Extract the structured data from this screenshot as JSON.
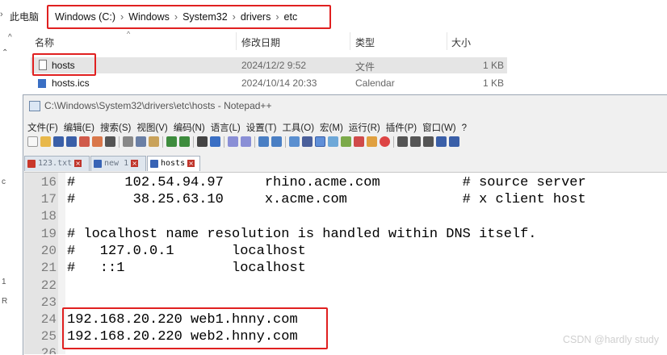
{
  "explorer": {
    "root_label": "此电脑",
    "breadcrumb": [
      "Windows (C:)",
      "Windows",
      "System32",
      "drivers",
      "etc"
    ],
    "columns": [
      "名称",
      "修改日期",
      "类型",
      "大小"
    ],
    "files": [
      {
        "name": "hosts",
        "date": "2024/12/2 9:52",
        "type": "文件",
        "size": "1 KB"
      },
      {
        "name": "hosts.ics",
        "date": "2024/10/14 20:33",
        "type": "Calendar",
        "size": "1 KB"
      }
    ]
  },
  "notepad": {
    "title": "C:\\Windows\\System32\\drivers\\etc\\hosts - Notepad++",
    "menu": [
      "文件(F)",
      "编辑(E)",
      "搜索(S)",
      "视图(V)",
      "编码(N)",
      "语言(L)",
      "设置(T)",
      "工具(O)",
      "宏(M)",
      "运行(R)",
      "插件(P)",
      "窗口(W)",
      "?"
    ],
    "tabs": [
      {
        "label": "123.txt"
      },
      {
        "label": "new 1"
      },
      {
        "label": "hosts"
      }
    ],
    "lines": [
      {
        "num": "16",
        "text": "#      102.54.94.97     rhino.acme.com          # source server"
      },
      {
        "num": "17",
        "text": "#       38.25.63.10     x.acme.com              # x client host"
      },
      {
        "num": "18",
        "text": ""
      },
      {
        "num": "19",
        "text": "# localhost name resolution is handled within DNS itself."
      },
      {
        "num": "20",
        "text": "#   127.0.0.1       localhost"
      },
      {
        "num": "21",
        "text": "#   ::1             localhost"
      },
      {
        "num": "22",
        "text": ""
      },
      {
        "num": "23",
        "text": ""
      },
      {
        "num": "24",
        "text": "192.168.20.220 web1.hnny.com"
      },
      {
        "num": "25",
        "text": "192.168.20.220 web2.hnny.com"
      },
      {
        "num": "26",
        "text": ""
      }
    ]
  },
  "watermark": "CSDN @hardly study",
  "colors": {
    "highlight": "#e02020",
    "selection": "#e5e5e5",
    "gutter": "#e4e4e4"
  }
}
